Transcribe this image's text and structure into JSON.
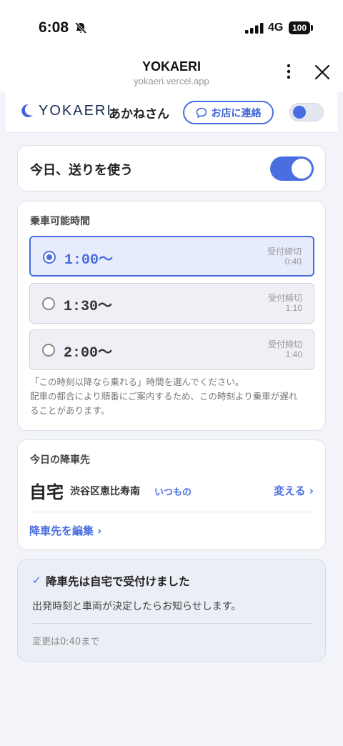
{
  "status_bar": {
    "time": "6:08",
    "network": "4G",
    "battery": "100"
  },
  "browser": {
    "title": "YOKAERI",
    "url": "yokaeri.vercel.app"
  },
  "header": {
    "logo_text": "YOKAERI",
    "user_name": "あかねさん",
    "contact_label": "お店に連絡"
  },
  "ride": {
    "label": "今日、送りを使う",
    "enabled": true
  },
  "time_section": {
    "title": "乗車可能時間",
    "slots": [
      {
        "time": "1:00〜",
        "deadline_label": "受付締切",
        "deadline": "0:40",
        "selected": true
      },
      {
        "time": "1:30〜",
        "deadline_label": "受付締切",
        "deadline": "1:10",
        "selected": false
      },
      {
        "time": "2:00〜",
        "deadline_label": "受付締切",
        "deadline": "1:40",
        "selected": false
      }
    ],
    "note_lines": [
      "「この時刻以降なら乗れる」時間を選んでください。",
      "配車の都合により順番にご案内するため、この時刻より乗車が遅れ",
      "ることがあります。"
    ]
  },
  "destination": {
    "title": "今日の降車先",
    "place": "自宅",
    "address": "渋谷区恵比寿南",
    "usual_tag": "いつもの",
    "change_label": "変える ›",
    "edit_label": "降車先を編集 ›"
  },
  "confirmation": {
    "check": "✓",
    "title": "降車先は自宅で受付けました",
    "body": "出発時刻と車両が決定したらお知らせします。",
    "deadline": "変更は0:40まで"
  },
  "colors": {
    "accent": "#4a6ee0",
    "background": "#f3f4fa"
  }
}
